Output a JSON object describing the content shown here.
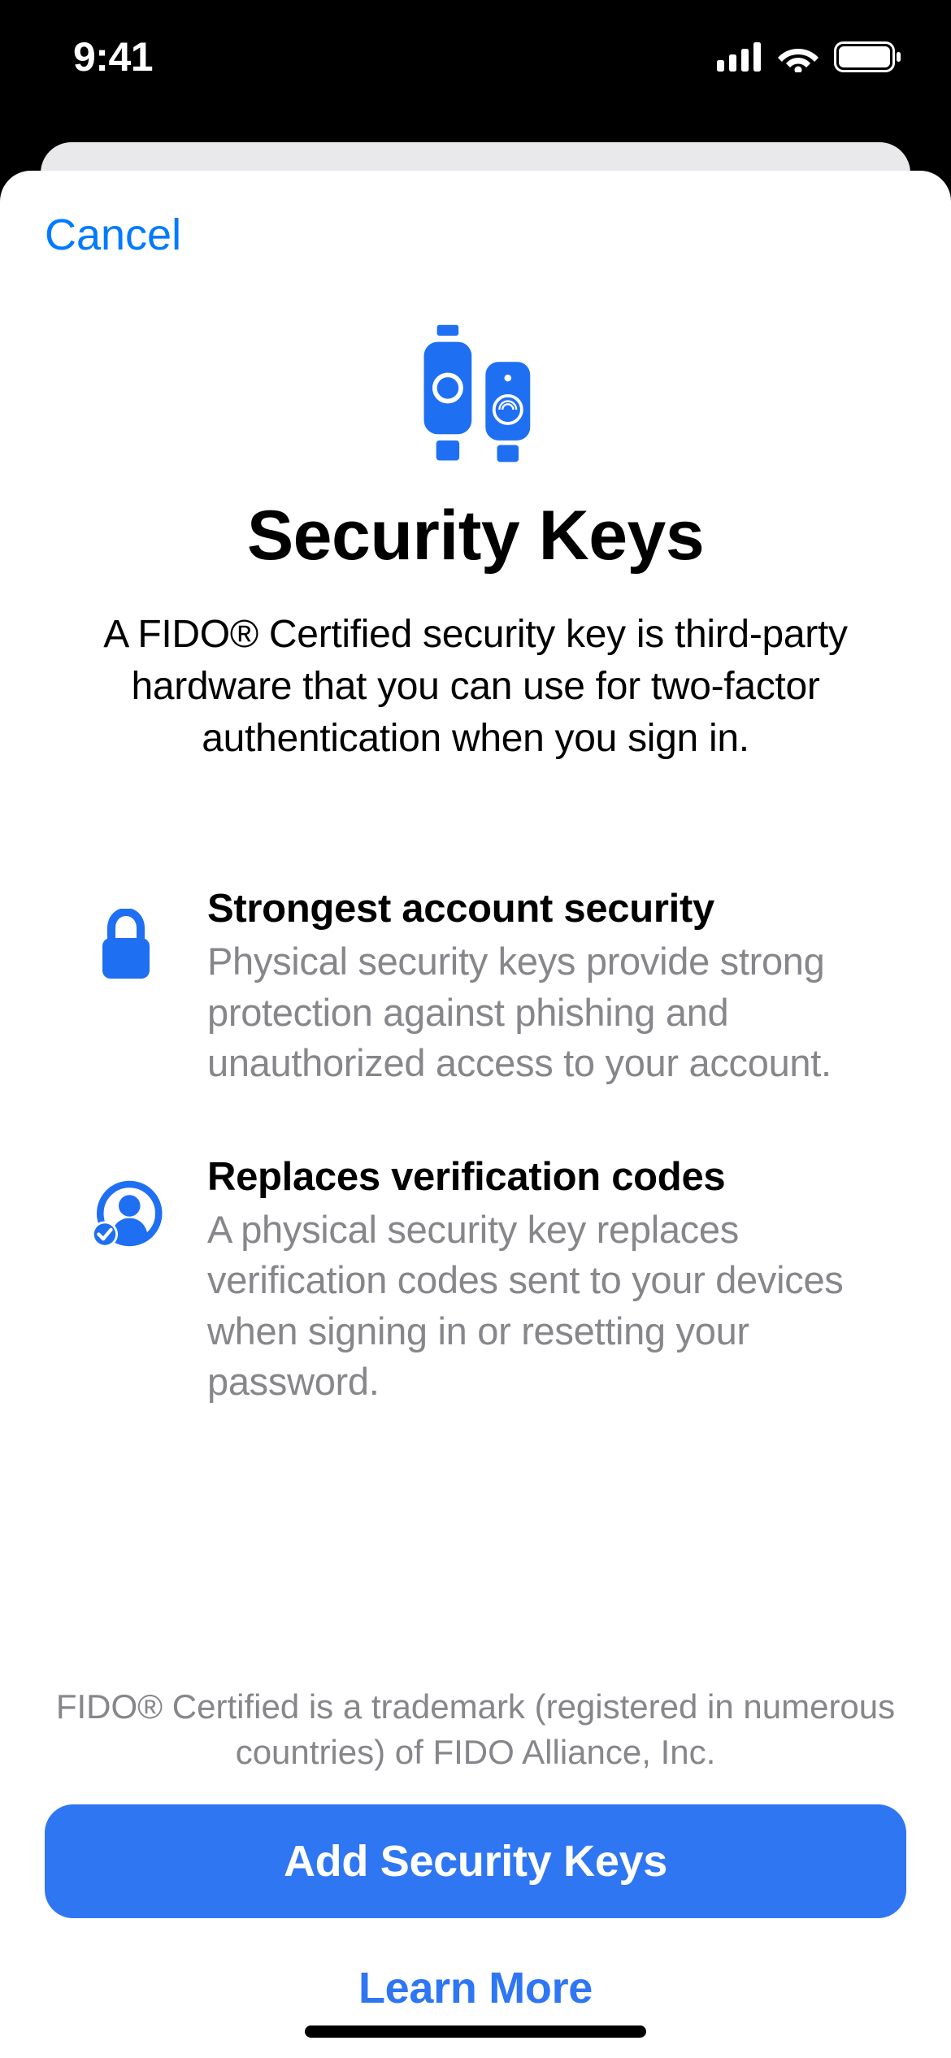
{
  "status": {
    "time": "9:41"
  },
  "nav": {
    "cancel": "Cancel"
  },
  "hero": {
    "title": "Security Keys",
    "subtitle": "A FIDO® Certified security key is third-party hardware that you can use for two-factor authentication when you sign in."
  },
  "features": [
    {
      "title": "Strongest account security",
      "desc": "Physical security keys provide strong protection against phishing and unauthorized access to your account."
    },
    {
      "title": "Replaces verification codes",
      "desc": "A physical security key replaces verification codes sent to your devices when signing in or resetting your password."
    }
  ],
  "footer": {
    "trademark": "FIDO® Certified is a trademark (registered in numerous countries) of FIDO Alliance, Inc.",
    "primary_button": "Add Security Keys",
    "secondary_button": "Learn More"
  }
}
